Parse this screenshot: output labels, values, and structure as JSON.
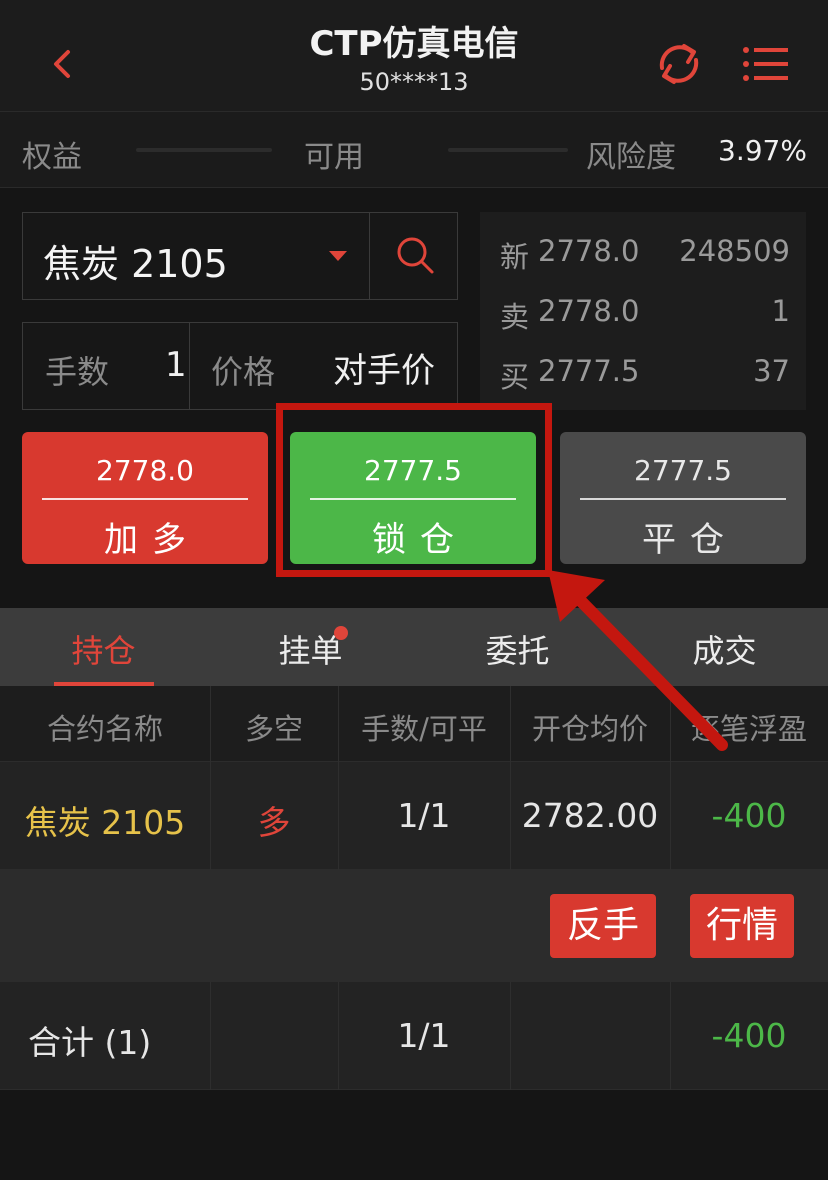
{
  "header": {
    "title": "CTP仿真电信",
    "account": "50****13"
  },
  "account_bar": {
    "equity_label": "权益",
    "available_label": "可用",
    "risk_label": "风险度",
    "risk_value": "3.97%"
  },
  "order": {
    "symbol": "焦炭 2105",
    "qty_label": "手数",
    "qty_value": "1",
    "price_label": "价格",
    "price_value": "对手价"
  },
  "quote": {
    "last_label": "新",
    "last_price": "2778.0",
    "volume": "248509",
    "ask_label": "卖",
    "ask_price": "2778.0",
    "ask_qty": "1",
    "bid_label": "买",
    "bid_price": "2777.5",
    "bid_qty": "37"
  },
  "trade_buttons": {
    "add_price": "2778.0",
    "add_label": "加多",
    "lock_price": "2777.5",
    "lock_label": "锁仓",
    "close_price": "2777.5",
    "close_label": "平仓"
  },
  "tabs": [
    "持仓",
    "挂单",
    "委托",
    "成交"
  ],
  "table": {
    "headers": [
      "合约名称",
      "多空",
      "手数/可平",
      "开仓均价",
      "逐笔浮盈"
    ],
    "rows": [
      {
        "name": "焦炭 2105",
        "direction": "多",
        "qty": "1/1",
        "avg_price": "2782.00",
        "pnl": "-400"
      }
    ],
    "actions": [
      "反手",
      "行情"
    ],
    "total": {
      "label": "合计 (1)",
      "qty": "1/1",
      "pnl": "-400"
    }
  },
  "colors": {
    "accent_red": "#d8392f",
    "accent_green": "#4cb748",
    "highlight": "#c4170f"
  }
}
